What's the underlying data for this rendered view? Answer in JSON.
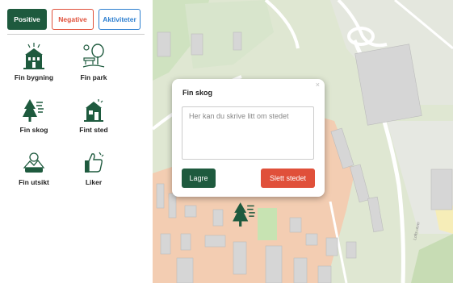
{
  "tabs": {
    "positive": "Positive",
    "negative": "Negative",
    "aktiviteter": "Aktiviteter"
  },
  "categories": [
    {
      "label": "Fin bygning",
      "icon": "building-icon"
    },
    {
      "label": "Fin park",
      "icon": "park-icon"
    },
    {
      "label": "Fin skog",
      "icon": "forest-icon"
    },
    {
      "label": "Fint sted",
      "icon": "place-icon"
    },
    {
      "label": "Fin utsikt",
      "icon": "view-icon"
    },
    {
      "label": "Liker",
      "icon": "thumbs-up-icon"
    }
  ],
  "popup": {
    "title": "Fin skog",
    "close": "×",
    "placeholder": "Her kan du skrive litt om stedet",
    "save": "Lagre",
    "delete": "Slett stedet"
  },
  "map": {
    "street_label": "Lofts utvei",
    "marker_icon": "forest-icon"
  },
  "colors": {
    "primary": "#1e5a3e",
    "negative": "#e0503a",
    "activity": "#2d7fd0"
  }
}
